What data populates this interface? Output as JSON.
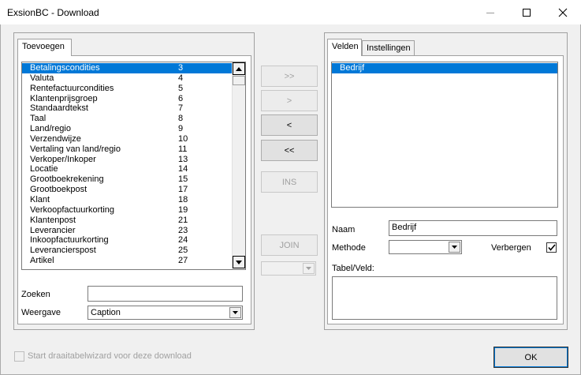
{
  "window": {
    "title": "ExsionBC - Download"
  },
  "left": {
    "tab_label": "Toevoegen",
    "items": [
      {
        "name": "Betalingscondities",
        "num": "3",
        "selected": true
      },
      {
        "name": "Valuta",
        "num": "4"
      },
      {
        "name": "Rentefactuurcondities",
        "num": "5"
      },
      {
        "name": "Klantenprijsgroep",
        "num": "6"
      },
      {
        "name": "Standaardtekst",
        "num": "7"
      },
      {
        "name": "Taal",
        "num": "8"
      },
      {
        "name": "Land/regio",
        "num": "9"
      },
      {
        "name": "Verzendwijze",
        "num": "10"
      },
      {
        "name": "Vertaling van land/regio",
        "num": "11"
      },
      {
        "name": "Verkoper/Inkoper",
        "num": "13"
      },
      {
        "name": "Locatie",
        "num": "14"
      },
      {
        "name": "Grootboekrekening",
        "num": "15"
      },
      {
        "name": "Grootboekpost",
        "num": "17"
      },
      {
        "name": "Klant",
        "num": "18"
      },
      {
        "name": "Verkoopfactuurkorting",
        "num": "19"
      },
      {
        "name": "Klantenpost",
        "num": "21"
      },
      {
        "name": "Leverancier",
        "num": "23"
      },
      {
        "name": "Inkoopfactuurkorting",
        "num": "24"
      },
      {
        "name": "Leverancierspost",
        "num": "25"
      },
      {
        "name": "Artikel",
        "num": "27"
      }
    ],
    "search_label": "Zoeken",
    "search_value": "",
    "display_label": "Weergave",
    "display_value": "Caption"
  },
  "middle": {
    "add_all": ">>",
    "add": ">",
    "remove": "<",
    "remove_all": "<<",
    "insert": "INS",
    "join": "JOIN",
    "join_combo_value": ""
  },
  "right": {
    "tab_fields": "Velden",
    "tab_settings": "Instellingen",
    "fields": [
      {
        "name": "Bedrijf",
        "selected": true
      }
    ],
    "name_label": "Naam",
    "name_value": "Bedrijf",
    "method_label": "Methode",
    "method_value": "",
    "hide_label": "Verbergen",
    "hide_checked": true,
    "table_field_label": "Tabel/Veld:",
    "table_field_value": ""
  },
  "footer": {
    "pivot_label": "Start draaitabelwizard voor deze download",
    "pivot_checked": false,
    "ok_label": "OK"
  }
}
